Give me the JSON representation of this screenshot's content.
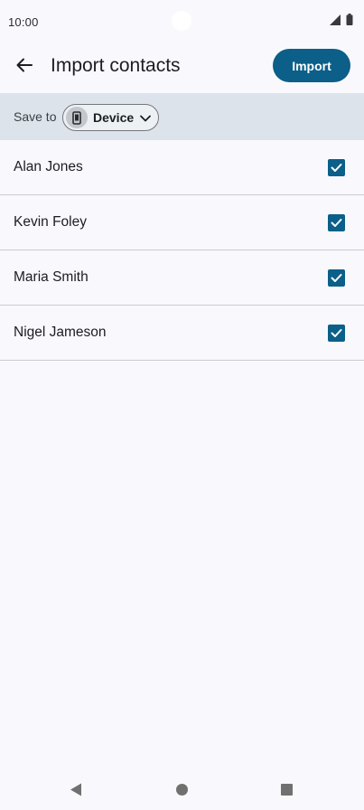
{
  "status_bar": {
    "time": "10:00",
    "icons": [
      "cell-signal-icon",
      "battery-icon"
    ]
  },
  "app_bar": {
    "back_icon": "arrow-back-icon",
    "title": "Import contacts",
    "import_label": "Import"
  },
  "save_bar": {
    "label": "Save to",
    "device_chip": {
      "icon": "phone-icon",
      "label": "Device",
      "chevron_icon": "chevron-down-icon"
    }
  },
  "contacts": [
    {
      "name": "Alan Jones",
      "checked": true
    },
    {
      "name": "Kevin Foley",
      "checked": true
    },
    {
      "name": "Maria Smith",
      "checked": true
    },
    {
      "name": "Nigel Jameson",
      "checked": true
    }
  ],
  "colors": {
    "accent": "#0b5f89",
    "save_bar_bg": "#dde3ea",
    "page_bg": "#f9f9fd"
  },
  "nav_bar": {
    "icons": [
      "nav-back-icon",
      "nav-home-icon",
      "nav-recents-icon"
    ]
  }
}
